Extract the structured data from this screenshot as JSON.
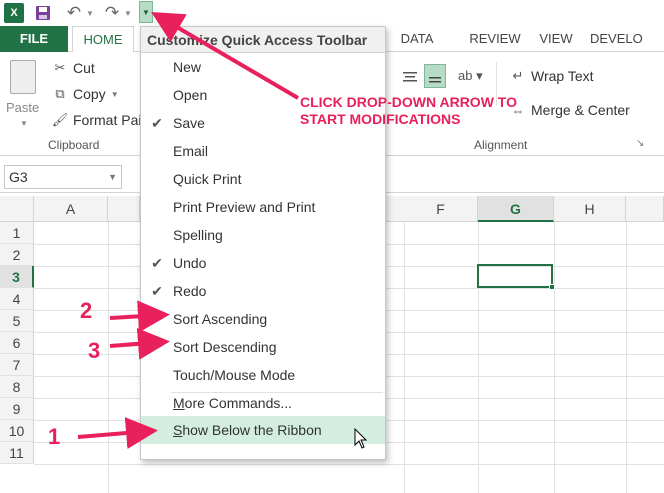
{
  "qat": {
    "app_icon_label": "X",
    "excel_icon": "excel-logo-icon",
    "save_icon": "save-icon",
    "undo_icon": "undo-icon",
    "redo_icon": "redo-icon",
    "customize_icon": "chevron-down-icon"
  },
  "tabs": {
    "file": "FILE",
    "home": "HOME",
    "data": "DATA",
    "review": "REVIEW",
    "view": "VIEW",
    "developer": "DEVELO"
  },
  "ribbon": {
    "paste": "Paste",
    "cut": "Cut",
    "copy": "Copy",
    "format_painter": "Format Pain",
    "clipboard_group": "Clipboard",
    "wrap_text": "Wrap Text",
    "merge_center": "Merge & Center",
    "alignment_group": "Alignment"
  },
  "formula_bar": {
    "name_box": "G3"
  },
  "grid": {
    "columns": [
      "A",
      "F",
      "G",
      "H"
    ],
    "rows": [
      "1",
      "2",
      "3",
      "4",
      "5",
      "6",
      "7",
      "8",
      "9",
      "10",
      "11"
    ],
    "selected_column": "G",
    "selected_row": "3"
  },
  "menu": {
    "title": "Customize Quick Access Toolbar",
    "items": [
      {
        "label": "New",
        "checked": false
      },
      {
        "label": "Open",
        "checked": false
      },
      {
        "label": "Save",
        "checked": true
      },
      {
        "label": "Email",
        "checked": false
      },
      {
        "label": "Quick Print",
        "checked": false
      },
      {
        "label": "Print Preview and Print",
        "checked": false
      },
      {
        "label": "Spelling",
        "checked": false
      },
      {
        "label": "Undo",
        "checked": true
      },
      {
        "label": "Redo",
        "checked": true
      },
      {
        "label": "Sort Ascending",
        "checked": false
      },
      {
        "label": "Sort Descending",
        "checked": false
      },
      {
        "label": "Touch/Mouse Mode",
        "checked": false
      }
    ],
    "more_commands": "More Commands...",
    "show_below": "Show Below the Ribbon",
    "check_glyph": "✔"
  },
  "annotations": {
    "callout_line1": "CLICK DROP-DOWN ARROW TO",
    "callout_line2": "START MODIFICATIONS",
    "num1": "1",
    "num2": "2",
    "num3": "3",
    "accent_color": "#e8205b"
  },
  "colors": {
    "excel_green": "#217346",
    "highlight": "#d3ede0"
  }
}
